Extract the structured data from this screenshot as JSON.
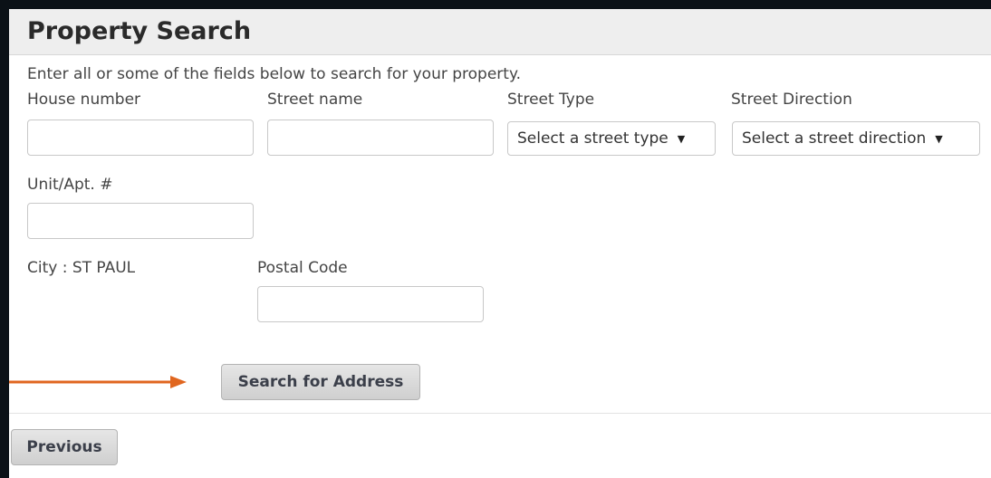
{
  "header": {
    "title": "Property Search"
  },
  "form": {
    "instructions": "Enter all or some of the fields below to search for your property.",
    "house_number": {
      "label": "House number",
      "value": "",
      "placeholder": ""
    },
    "street_name": {
      "label": "Street name",
      "value": "",
      "placeholder": ""
    },
    "street_type": {
      "label": "Street Type",
      "selected": "Select a street type"
    },
    "street_direction": {
      "label": "Street Direction",
      "selected": "Select a street direction"
    },
    "unit": {
      "label": "Unit/Apt. #",
      "value": "",
      "placeholder": ""
    },
    "city": "City : ST PAUL",
    "postal_code": {
      "label": "Postal Code",
      "value": "",
      "placeholder": ""
    },
    "search_button": "Search for Address"
  },
  "footer": {
    "previous_button": "Previous"
  },
  "annotation": {
    "arrow_color": "#e0661f"
  },
  "colors": {
    "frame": "#0b1117",
    "header_bg": "#eeeeee",
    "button_text": "#3b3f4a"
  }
}
